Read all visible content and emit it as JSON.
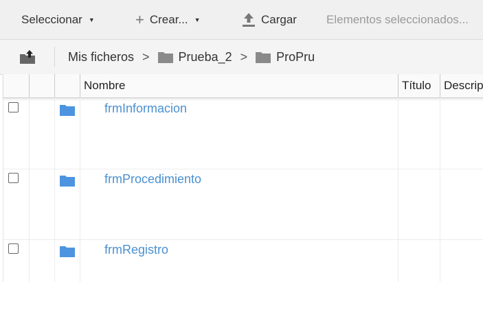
{
  "toolbar": {
    "select_label": "Seleccionar",
    "create_label": "Crear...",
    "upload_label": "Cargar",
    "selected_items_label": "Elementos seleccionados..."
  },
  "breadcrumb": {
    "root": "Mis ficheros",
    "separator": ">",
    "items": [
      "Prueba_2",
      "ProPru"
    ]
  },
  "table": {
    "columns": [
      "Nombre",
      "Título",
      "Descripción"
    ],
    "rows": [
      {
        "name": "frmInformacion"
      },
      {
        "name": "frmProcedimiento"
      },
      {
        "name": "frmRegistro"
      }
    ]
  },
  "colors": {
    "folder": "#4d94e0",
    "link": "#4a90d0",
    "toolbar_bg": "#f0f0f0"
  },
  "icons": {
    "create": "plus-icon",
    "upload": "upload-icon",
    "parent": "parent-folder-icon",
    "folder": "folder-icon"
  }
}
